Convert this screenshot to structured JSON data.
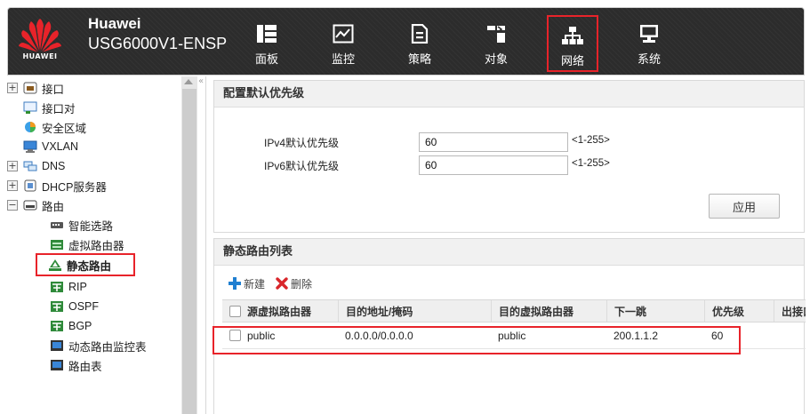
{
  "header": {
    "brand": "Huawei",
    "model": "USG6000V1-ENSP",
    "logo_text": "HUAWEI",
    "nav": [
      {
        "label": "面板",
        "icon": "dashboard-icon"
      },
      {
        "label": "监控",
        "icon": "monitor-icon"
      },
      {
        "label": "策略",
        "icon": "policy-icon"
      },
      {
        "label": "对象",
        "icon": "object-icon"
      },
      {
        "label": "网络",
        "icon": "network-icon",
        "active": true
      },
      {
        "label": "系统",
        "icon": "system-icon"
      }
    ]
  },
  "sidebar": {
    "collapse_glyph": "«",
    "items": [
      {
        "label": "接口",
        "expander": "+",
        "icon": "interface-icon"
      },
      {
        "label": "接口对",
        "icon": "interface-pair-icon"
      },
      {
        "label": "安全区域",
        "icon": "security-zone-icon"
      },
      {
        "label": "VXLAN",
        "icon": "vxlan-icon"
      },
      {
        "label": "DNS",
        "expander": "+",
        "icon": "dns-icon"
      },
      {
        "label": "DHCP服务器",
        "expander": "+",
        "icon": "dhcp-server-icon"
      },
      {
        "label": "路由",
        "expander": "−",
        "icon": "routing-icon"
      },
      {
        "label": "智能选路",
        "icon": "smart-routing-icon"
      },
      {
        "label": "虚拟路由器",
        "icon": "virtual-router-icon"
      },
      {
        "label": "静态路由",
        "icon": "static-route-icon",
        "selected": true
      },
      {
        "label": "RIP",
        "icon": "rip-icon"
      },
      {
        "label": "OSPF",
        "icon": "ospf-icon"
      },
      {
        "label": "BGP",
        "icon": "bgp-icon"
      },
      {
        "label": "动态路由监控表",
        "icon": "dynamic-route-monitor-icon"
      },
      {
        "label": "路由表",
        "icon": "route-table-icon"
      }
    ]
  },
  "priority_panel": {
    "title": "配置默认优先级",
    "ipv4_label": "IPv4默认优先级",
    "ipv4_value": "60",
    "ipv4_range": "<1-255>",
    "ipv6_label": "IPv6默认优先级",
    "ipv6_value": "60",
    "ipv6_range": "<1-255>",
    "apply_label": "应用"
  },
  "route_panel": {
    "title": "静态路由列表",
    "new_label": "新建",
    "delete_label": "删除",
    "columns": [
      "源虚拟路由器",
      "目的地址/掩码",
      "目的虚拟路由器",
      "下一跳",
      "优先级",
      "出接口"
    ],
    "rows": [
      [
        "public",
        "0.0.0.0/0.0.0.0",
        "public",
        "200.1.1.2",
        "60",
        ""
      ]
    ]
  },
  "colors": {
    "header_bg": "#2c2c2c",
    "highlight": "#e8232a",
    "accent_blue": "#1f7fd1"
  }
}
